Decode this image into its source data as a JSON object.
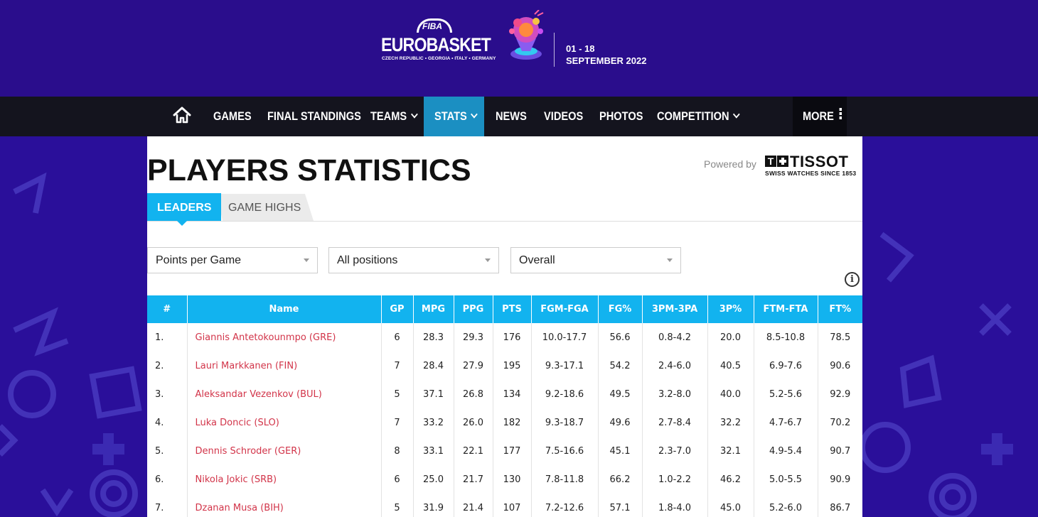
{
  "brand": {
    "fiba": "FIBA",
    "title": "EUROBASKET",
    "hosts": "CZECH REPUBLIC • GEORGIA • ITALY • GERMANY",
    "dates_line1": "01 - 18",
    "dates_line2": "SEPTEMBER 2022",
    "colors": {
      "header_bg": "#2a0d8c",
      "nav_bg": "#14141e",
      "accent": "#12b3ef",
      "nav_active": "#1b8fc2",
      "link": "#d23449"
    }
  },
  "nav": {
    "home_icon": "home-icon",
    "items": [
      {
        "label": "GAMES"
      },
      {
        "label": "FINAL STANDINGS"
      },
      {
        "label": "TEAMS"
      },
      {
        "label": "STATS"
      },
      {
        "label": "NEWS"
      },
      {
        "label": "VIDEOS"
      },
      {
        "label": "PHOTOS"
      },
      {
        "label": "COMPETITION"
      }
    ],
    "more": "MORE",
    "active": "STATS"
  },
  "page": {
    "title": "PLAYERS STATISTICS",
    "powered_by": "Powered by",
    "sponsor": "TISSOT",
    "sponsor_tagline": "SWISS WATCHES SINCE 1853",
    "sponsor_mark": "T"
  },
  "tabs": [
    {
      "label": "LEADERS",
      "active": true
    },
    {
      "label": "GAME HIGHS",
      "active": false
    }
  ],
  "filters": {
    "stat": "Points per Game",
    "position": "All positions",
    "phase": "Overall"
  },
  "info_icon": "i",
  "table": {
    "columns": [
      "#",
      "Name",
      "GP",
      "MPG",
      "PPG",
      "PTS",
      "FGM-FGA",
      "FG%",
      "3PM-3PA",
      "3P%",
      "FTM-FTA",
      "FT%"
    ],
    "rows": [
      [
        "1.",
        "Giannis Antetokounmpo (GRE)",
        "6",
        "28.3",
        "29.3",
        "176",
        "10.0-17.7",
        "56.6",
        "0.8-4.2",
        "20.0",
        "8.5-10.8",
        "78.5"
      ],
      [
        "2.",
        "Lauri Markkanen (FIN)",
        "7",
        "28.4",
        "27.9",
        "195",
        "9.3-17.1",
        "54.2",
        "2.4-6.0",
        "40.5",
        "6.9-7.6",
        "90.6"
      ],
      [
        "3.",
        "Aleksandar Vezenkov (BUL)",
        "5",
        "37.1",
        "26.8",
        "134",
        "9.2-18.6",
        "49.5",
        "3.2-8.0",
        "40.0",
        "5.2-5.6",
        "92.9"
      ],
      [
        "4.",
        "Luka Doncic (SLO)",
        "7",
        "33.2",
        "26.0",
        "182",
        "9.3-18.7",
        "49.6",
        "2.7-8.4",
        "32.2",
        "4.7-6.7",
        "70.2"
      ],
      [
        "5.",
        "Dennis Schroder (GER)",
        "8",
        "33.1",
        "22.1",
        "177",
        "7.5-16.6",
        "45.1",
        "2.3-7.0",
        "32.1",
        "4.9-5.4",
        "90.7"
      ],
      [
        "6.",
        "Nikola Jokic (SRB)",
        "6",
        "25.0",
        "21.7",
        "130",
        "7.8-11.8",
        "66.2",
        "1.0-2.2",
        "46.2",
        "5.0-5.5",
        "90.9"
      ],
      [
        "7.",
        "Dzanan Musa (BIH)",
        "5",
        "31.9",
        "21.4",
        "107",
        "7.2-12.6",
        "57.1",
        "1.8-4.0",
        "45.0",
        "5.2-6.0",
        "86.7"
      ]
    ]
  }
}
